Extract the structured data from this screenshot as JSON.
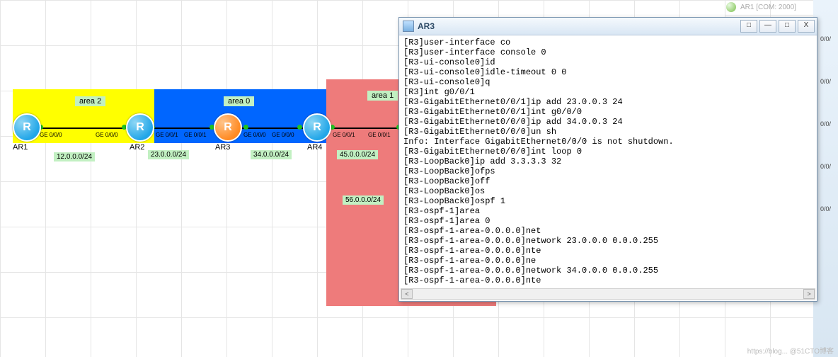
{
  "window": {
    "title": "AR3",
    "buttons": {
      "hidden": "□",
      "min": "—",
      "max": "□",
      "close": "X"
    }
  },
  "ghost": {
    "title": "AR1 [COM: 2000]"
  },
  "cli_lines": [
    "[R3]user-interface co",
    "[R3]user-interface console 0",
    "[R3-ui-console0]id",
    "[R3-ui-console0]idle-timeout 0 0",
    "[R3-ui-console0]q",
    "[R3]int g0/0/1",
    "[R3-GigabitEthernet0/0/1]ip add 23.0.0.3 24",
    "[R3-GigabitEthernet0/0/1]int g0/0/0",
    "[R3-GigabitEthernet0/0/0]ip add 34.0.0.3 24",
    "[R3-GigabitEthernet0/0/0]un sh",
    "Info: Interface GigabitEthernet0/0/0 is not shutdown.",
    "[R3-GigabitEthernet0/0/0]int loop 0",
    "[R3-LoopBack0]ip add 3.3.3.3 32",
    "[R3-LoopBack0]ofps",
    "[R3-LoopBack0]off",
    "[R3-LoopBack0]os",
    "[R3-LoopBack0]ospf 1",
    "[R3-ospf-1]area",
    "[R3-ospf-1]area 0",
    "[R3-ospf-1-area-0.0.0.0]net",
    "[R3-ospf-1-area-0.0.0.0]network 23.0.0.0 0.0.0.255",
    "[R3-ospf-1-area-0.0.0.0]nte",
    "[R3-ospf-1-area-0.0.0.0]ne",
    "[R3-ospf-1-area-0.0.0.0]network 34.0.0.0 0.0.0.255",
    "[R3-ospf-1-area-0.0.0.0]nte"
  ],
  "topology": {
    "areas": {
      "a2": "area 2",
      "a0": "area 0",
      "a1": "area 1"
    },
    "routers": {
      "AR1": "AR1",
      "AR2": "AR2",
      "AR3": "AR3",
      "AR4": "AR4"
    },
    "subnets": {
      "s12": "12.0.0.0/24",
      "s23": "23.0.0.0/24",
      "s34": "34.0.0.0/24",
      "s45": "45.0.0.0/24",
      "s56": "56.0.0.0/24"
    },
    "ifs": {
      "ar1g0": "GE 0/0/0",
      "ar2g0": "GE 0/0/0",
      "ar2g1": "GE 0/0/1",
      "ar3g1": "GE 0/0/1",
      "ar3g0": "GE 0/0/0",
      "ar4g0": "GE 0/0/0",
      "ar4g1": "GE 0/0/1",
      "ar5g1": "GE 0/0/1"
    }
  },
  "right_buttons": [
    "0/0/",
    "0/0/",
    "0/0/",
    "0/0/",
    "0/0/"
  ],
  "watermark": "https://blog... @51CTO博客"
}
